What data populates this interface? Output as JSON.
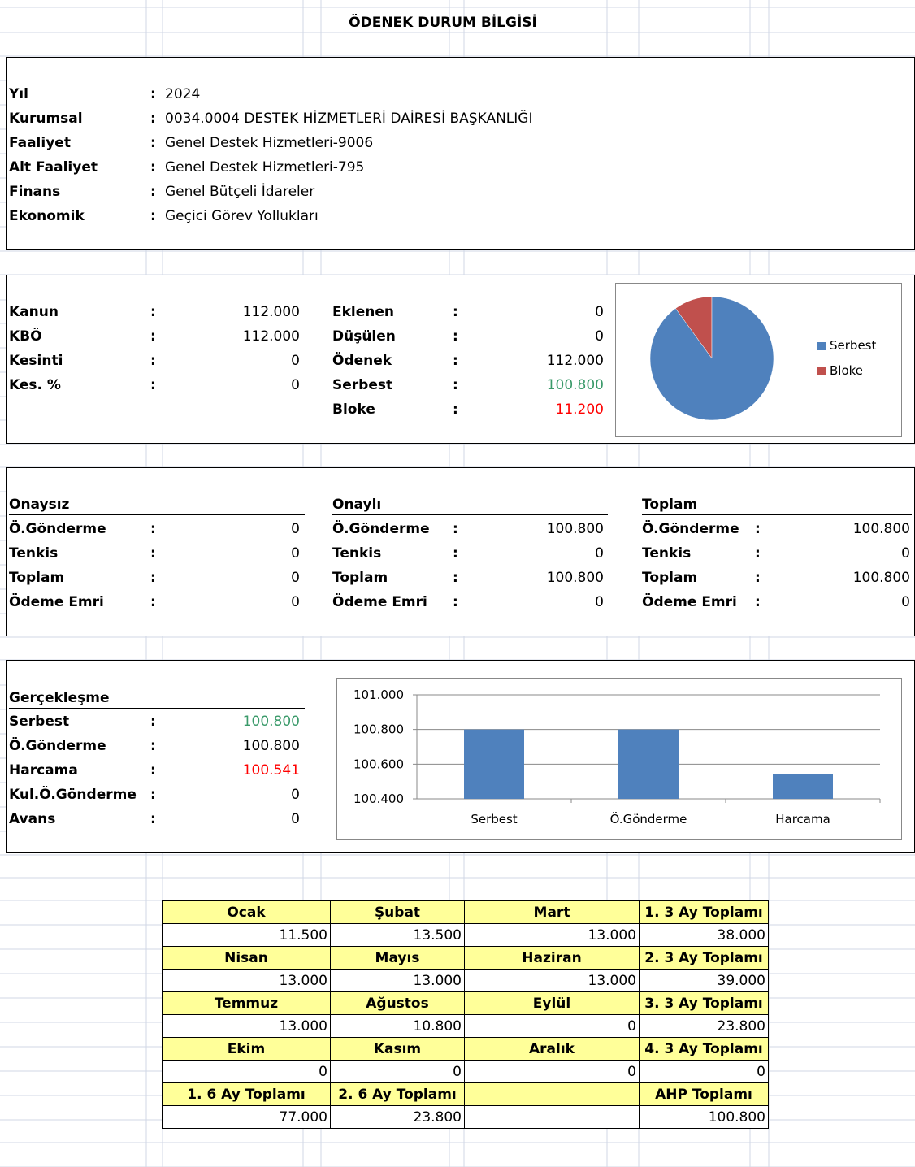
{
  "title": "ÖDENEK DURUM BİLGİSİ",
  "info": [
    {
      "label": "Yıl",
      "value": "2024"
    },
    {
      "label": "Kurumsal",
      "value": "0034.0004 DESTEK HİZMETLERİ DAİRESİ BAŞKANLIĞI"
    },
    {
      "label": "Faaliyet",
      "value": "Genel Destek Hizmetleri-9006"
    },
    {
      "label": "Alt Faaliyet",
      "value": "Genel Destek Hizmetleri-795"
    },
    {
      "label": "Finans",
      "value": "Genel Bütçeli İdareler"
    },
    {
      "label": "Ekonomik",
      "value": "Geçici Görev Yollukları"
    }
  ],
  "budget": {
    "left": [
      {
        "label": "Kanun",
        "value": "112.000"
      },
      {
        "label": "KBÖ",
        "value": "112.000"
      },
      {
        "label": "Kesinti",
        "value": "0"
      },
      {
        "label": "Kes. %",
        "value": "0"
      }
    ],
    "right": [
      {
        "label": "Eklenen",
        "value": "0"
      },
      {
        "label": "Düşülen",
        "value": "0"
      },
      {
        "label": "Ödenek",
        "value": "112.000"
      },
      {
        "label": "Serbest",
        "value": "100.800"
      },
      {
        "label": "Bloke",
        "value": "11.200"
      }
    ]
  },
  "pie": {
    "legend": [
      {
        "name": "Serbest",
        "color": "#4f81bd",
        "value": 100800
      },
      {
        "name": "Bloke",
        "color": "#c0504d",
        "value": 11200
      }
    ]
  },
  "approval": {
    "sections": [
      {
        "title": "Onaysız",
        "rows": [
          {
            "label": "Ö.Gönderme",
            "value": "0"
          },
          {
            "label": "Tenkis",
            "value": "0"
          },
          {
            "label": "Toplam",
            "value": "0"
          },
          {
            "label": "Ödeme Emri",
            "value": "0"
          }
        ]
      },
      {
        "title": "Onaylı",
        "rows": [
          {
            "label": "Ö.Gönderme",
            "value": "100.800"
          },
          {
            "label": "Tenkis",
            "value": "0"
          },
          {
            "label": "Toplam",
            "value": "100.800"
          },
          {
            "label": "Ödeme Emri",
            "value": "0"
          }
        ]
      },
      {
        "title": "Toplam",
        "rows": [
          {
            "label": "Ö.Gönderme",
            "value": "100.800"
          },
          {
            "label": "Tenkis",
            "value": "0"
          },
          {
            "label": "Toplam",
            "value": "100.800"
          },
          {
            "label": "Ödeme Emri",
            "value": "0"
          }
        ]
      }
    ]
  },
  "realization": {
    "title": "Gerçekleşme",
    "rows": [
      {
        "label": "Serbest",
        "value": "100.800"
      },
      {
        "label": "Ö.Gönderme",
        "value": "100.800"
      },
      {
        "label": "Harcama",
        "value": "100.541"
      },
      {
        "label": "Kul.Ö.Gönderme",
        "value": "0"
      },
      {
        "label": "Avans",
        "value": "0"
      }
    ]
  },
  "chart_data": [
    {
      "type": "pie",
      "labels": [
        "Serbest",
        "Bloke"
      ],
      "values": [
        100800,
        11200
      ],
      "colors": [
        "#4f81bd",
        "#c0504d"
      ],
      "legend": "right"
    },
    {
      "type": "bar",
      "categories": [
        "Serbest",
        "Ö.Gönderme",
        "Harcama"
      ],
      "values": [
        100800,
        100800,
        100541
      ],
      "ylim": [
        100400,
        101000
      ],
      "yticks": [
        "101.000",
        "100.800",
        "100.600",
        "100.400"
      ],
      "grid": true,
      "color": "#4f81bd"
    }
  ],
  "months": {
    "rows": [
      {
        "headers": [
          "Ocak",
          "Şubat",
          "Mart",
          "1. 3 Ay Toplamı"
        ],
        "values": [
          "11.500",
          "13.500",
          "13.000",
          "38.000"
        ]
      },
      {
        "headers": [
          "Nisan",
          "Mayıs",
          "Haziran",
          "2. 3 Ay Toplamı"
        ],
        "values": [
          "13.000",
          "13.000",
          "13.000",
          "39.000"
        ]
      },
      {
        "headers": [
          "Temmuz",
          "Ağustos",
          "Eylül",
          "3. 3 Ay Toplamı"
        ],
        "values": [
          "13.000",
          "10.800",
          "0",
          "23.800"
        ]
      },
      {
        "headers": [
          "Ekim",
          "Kasım",
          "Aralık",
          "4. 3 Ay Toplamı"
        ],
        "values": [
          "0",
          "0",
          "0",
          "0"
        ]
      },
      {
        "headers": [
          "1. 6 Ay Toplamı",
          "2. 6 Ay Toplamı",
          "",
          "AHP Toplamı"
        ],
        "values": [
          "77.000",
          "23.800",
          "",
          "100.800"
        ]
      }
    ]
  }
}
